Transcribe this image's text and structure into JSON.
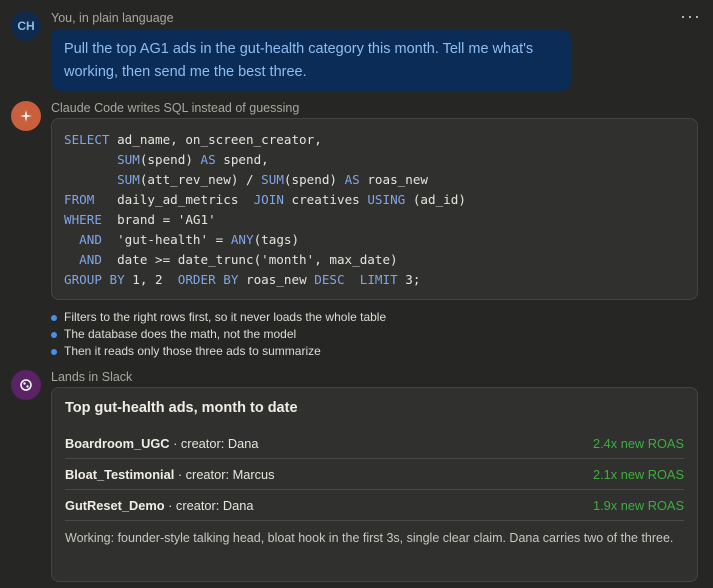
{
  "more_menu": "···",
  "user": {
    "initials": "CH",
    "label": "You, in plain language",
    "message": "Pull the top AG1 ads in the gut-health category this month. Tell me what's working, then send me the best three."
  },
  "claude": {
    "icon": "sparkle-icon",
    "label": "Claude Code writes SQL instead of guessing",
    "sql_lines": [
      "SELECT ad_name, on_screen_creator,",
      "       SUM(spend) AS spend,",
      "       SUM(att_rev_new) / SUM(spend) AS roas_new",
      "FROM   daily_ad_metrics  JOIN creatives USING (ad_id)",
      "WHERE  brand = 'AG1'",
      "  AND  'gut-health' = ANY(tags)",
      "  AND  date >= date_trunc('month', max_date)",
      "GROUP BY 1, 2  ORDER BY roas_new DESC  LIMIT 3;"
    ],
    "bullets": [
      "Filters to the right rows first, so it never loads the whole table",
      "The database does the math, not the model",
      "Then it reads only those three ads to summarize"
    ]
  },
  "slack": {
    "icon": "slack-icon",
    "label": "Lands in Slack",
    "card_title": "Top gut-health ads, month to date",
    "ads": [
      {
        "name": "Boardroom_UGC",
        "creator": " · creator: Dana",
        "roas": "2.4x new ROAS"
      },
      {
        "name": "Bloat_Testimonial",
        "creator": " · creator: Marcus",
        "roas": "2.1x new ROAS"
      },
      {
        "name": "GutReset_Demo",
        "creator": " · creator: Dana",
        "roas": "1.9x new ROAS"
      }
    ],
    "summary": "Working: founder-style talking head, bloat hook in the first 3s, single clear claim. Dana carries two of the three."
  },
  "colors": {
    "background": "#262624",
    "user_bubble": "#0b2c57",
    "user_text": "#8ebdf2",
    "keyword": "#7fa6e6",
    "roas_green": "#3fae3f",
    "bullet_blue": "#4c8ee6"
  }
}
